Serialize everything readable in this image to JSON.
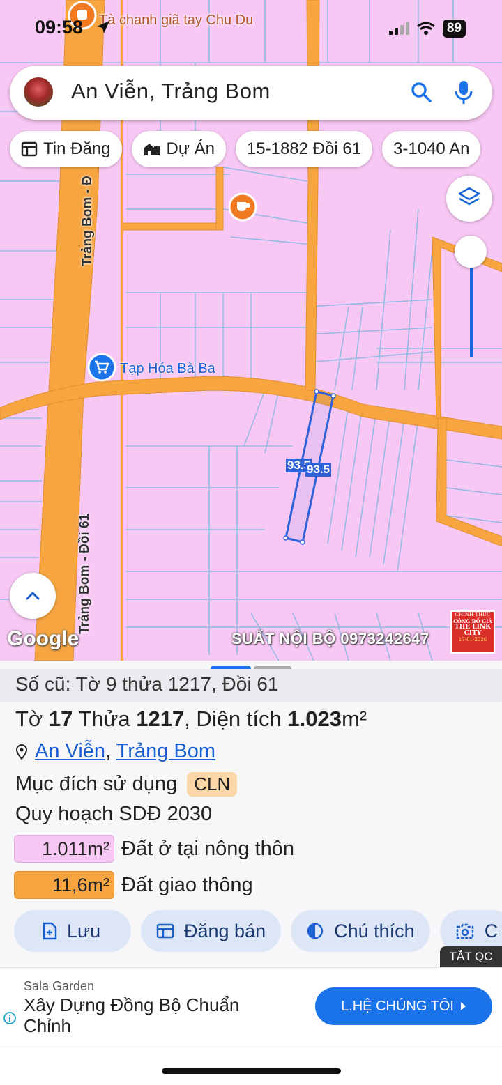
{
  "status_bar": {
    "time": "09:58",
    "battery": "89"
  },
  "search": {
    "query": "An Viễn, Trảng Bom"
  },
  "chips": [
    {
      "label": "Tin Đăng",
      "icon": "listing-icon"
    },
    {
      "label": "Dự Án",
      "icon": "project-building-icon"
    },
    {
      "label": "15-1882 Đồi 61"
    },
    {
      "label": "3-1040 An"
    }
  ],
  "map": {
    "poi_top": "Tà chanh giã tay Chu Du",
    "poi_store": "Tạp Hóa Bà Ba",
    "road_label_1": "Trảng Bom - Đ",
    "road_label_2": "Trảng Bom - Đồi 61",
    "dim_1": "93.5",
    "dim_2": "93.5",
    "google": "Google",
    "watermark": "SUẤT NỘI BỘ 0973242647",
    "stamp_lines": [
      "CHÍNH THỨC",
      "CÔNG BỐ GIÁ",
      "THE LINK",
      "CITY",
      "17-01-2026"
    ]
  },
  "parcel": {
    "old_info": "Số cũ: Tờ 9 thửa 1217, Đồi 61",
    "sheet_label": "Tờ ",
    "sheet_no": "17",
    "lot_label": " Thửa ",
    "lot_no": "1217",
    "area_label": ", Diện tích ",
    "area_value": "1.023",
    "area_unit": "m²",
    "commune": "An Viễn",
    "separator": ", ",
    "district": "Trảng Bom",
    "usage_label": "Mục đích sử dụng",
    "usage_code": "CLN",
    "plan_label": "Quy hoạch SDĐ 2030",
    "zones": [
      {
        "area": "1.011m²",
        "label": "Đất ở tại nông thôn",
        "color": "#f8c8f4"
      },
      {
        "area": "11,6m²",
        "label": "Đất giao thông",
        "color": "#f7a540"
      }
    ]
  },
  "actions": [
    {
      "label": "Lưu",
      "icon": "save-add-icon"
    },
    {
      "label": "Đăng bán",
      "icon": "listing-icon"
    },
    {
      "label": "Chú thích",
      "icon": "contrast-icon"
    },
    {
      "label": "C",
      "icon": "camera-icon"
    }
  ],
  "ad": {
    "hide_label": "TẮT QC",
    "sponsor": "Sala Garden",
    "title": "Xây Dựng Đồng Bộ Chuẩn Chỉnh",
    "button": "L.HỆ CHÚNG TÔI"
  },
  "colors": {
    "residential": "#f8c8f4",
    "road": "#f7a540",
    "accent": "#1a73e8",
    "parcel_line": "#2f62d8"
  }
}
